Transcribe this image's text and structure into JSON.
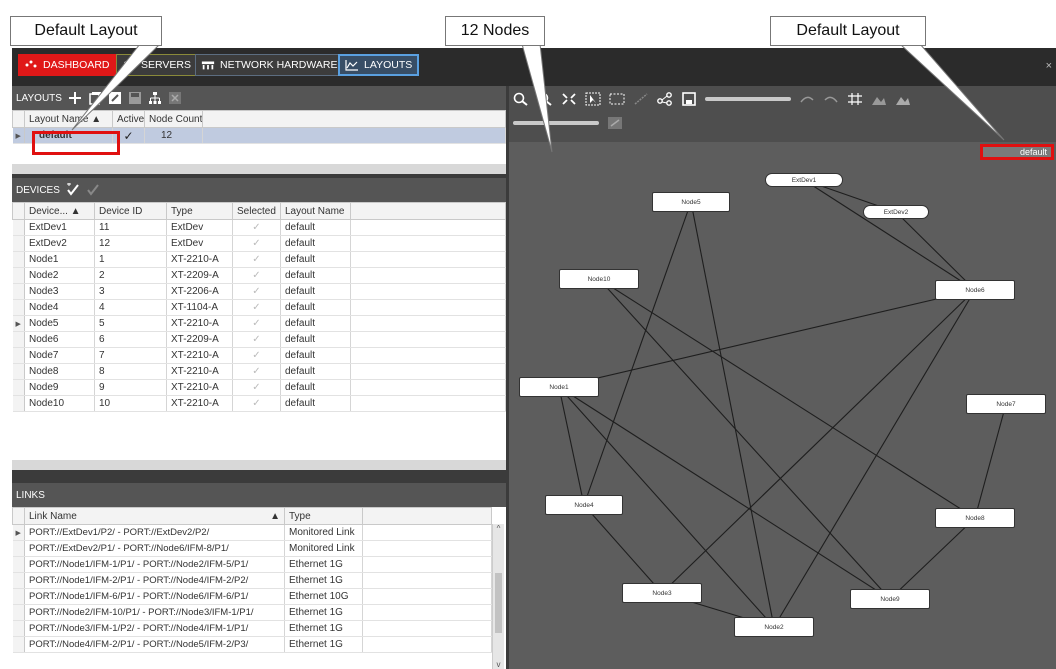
{
  "annotations": {
    "left_callout": "Default Layout",
    "middle_callout": "12 Nodes",
    "right_callout": "Default Layout"
  },
  "tabs": [
    {
      "label": "DASHBOARD"
    },
    {
      "label": "SERVERS"
    },
    {
      "label": "NETWORK HARDWARE"
    },
    {
      "label": "LAYOUTS"
    }
  ],
  "window": {
    "close": "×"
  },
  "layouts": {
    "header": "LAYOUTS",
    "columns": [
      "Layout Name",
      "Active",
      "Node Count"
    ],
    "rows": [
      {
        "name": "default",
        "active": "✓",
        "count": "12"
      }
    ]
  },
  "devices": {
    "header": "DEVICES",
    "columns": [
      "Device...",
      "Device ID",
      "Type",
      "Selected",
      "Layout Name"
    ],
    "rows": [
      {
        "name": "ExtDev1",
        "id": "11",
        "type": "ExtDev",
        "selected": "✓",
        "layout": "default"
      },
      {
        "name": "ExtDev2",
        "id": "12",
        "type": "ExtDev",
        "selected": "✓",
        "layout": "default"
      },
      {
        "name": "Node1",
        "id": "1",
        "type": "XT-2210-A",
        "selected": "✓",
        "layout": "default"
      },
      {
        "name": "Node2",
        "id": "2",
        "type": "XT-2209-A",
        "selected": "✓",
        "layout": "default"
      },
      {
        "name": "Node3",
        "id": "3",
        "type": "XT-2206-A",
        "selected": "✓",
        "layout": "default"
      },
      {
        "name": "Node4",
        "id": "4",
        "type": "XT-1104-A",
        "selected": "✓",
        "layout": "default"
      },
      {
        "name": "Node5",
        "id": "5",
        "type": "XT-2210-A",
        "selected": "✓",
        "layout": "default"
      },
      {
        "name": "Node6",
        "id": "6",
        "type": "XT-2209-A",
        "selected": "✓",
        "layout": "default"
      },
      {
        "name": "Node7",
        "id": "7",
        "type": "XT-2210-A",
        "selected": "✓",
        "layout": "default"
      },
      {
        "name": "Node8",
        "id": "8",
        "type": "XT-2210-A",
        "selected": "✓",
        "layout": "default"
      },
      {
        "name": "Node9",
        "id": "9",
        "type": "XT-2210-A",
        "selected": "✓",
        "layout": "default"
      },
      {
        "name": "Node10",
        "id": "10",
        "type": "XT-2210-A",
        "selected": "✓",
        "layout": "default"
      }
    ]
  },
  "links": {
    "header": "LINKS",
    "columns": [
      "Link Name",
      "Type"
    ],
    "rows": [
      {
        "name": "PORT://ExtDev1/P2/ - PORT://ExtDev2/P2/",
        "type": "Monitored Link"
      },
      {
        "name": "PORT://ExtDev2/P1/ - PORT://Node6/IFM-8/P1/",
        "type": "Monitored Link"
      },
      {
        "name": "PORT://Node1/IFM-1/P1/ - PORT://Node2/IFM-5/P1/",
        "type": "Ethernet 1G"
      },
      {
        "name": "PORT://Node1/IFM-2/P1/ - PORT://Node4/IFM-2/P2/",
        "type": "Ethernet 1G"
      },
      {
        "name": "PORT://Node1/IFM-6/P1/ - PORT://Node6/IFM-6/P1/",
        "type": "Ethernet 10G"
      },
      {
        "name": "PORT://Node2/IFM-10/P1/ - PORT://Node3/IFM-1/P1/",
        "type": "Ethernet 1G"
      },
      {
        "name": "PORT://Node3/IFM-1/P2/ - PORT://Node4/IFM-1/P1/",
        "type": "Ethernet 1G"
      },
      {
        "name": "PORT://Node4/IFM-2/P1/ - PORT://Node5/IFM-2/P3/",
        "type": "Ethernet 1G"
      }
    ]
  },
  "graph": {
    "layout_label": "default",
    "nodes": [
      {
        "id": "ExtDev1",
        "label": "ExtDev1",
        "kind": "ext"
      },
      {
        "id": "ExtDev2",
        "label": "ExtDev2",
        "kind": "ext"
      },
      {
        "id": "Node5",
        "label": "Node5",
        "kind": "node"
      },
      {
        "id": "Node10",
        "label": "Node10",
        "kind": "node"
      },
      {
        "id": "Node6",
        "label": "Node6",
        "kind": "node"
      },
      {
        "id": "Node1",
        "label": "Node1",
        "kind": "node"
      },
      {
        "id": "Node7",
        "label": "Node7",
        "kind": "node"
      },
      {
        "id": "Node4",
        "label": "Node4",
        "kind": "node"
      },
      {
        "id": "Node8",
        "label": "Node8",
        "kind": "node"
      },
      {
        "id": "Node3",
        "label": "Node3",
        "kind": "node"
      },
      {
        "id": "Node9",
        "label": "Node9",
        "kind": "node"
      },
      {
        "id": "Node2",
        "label": "Node2",
        "kind": "node"
      }
    ]
  }
}
